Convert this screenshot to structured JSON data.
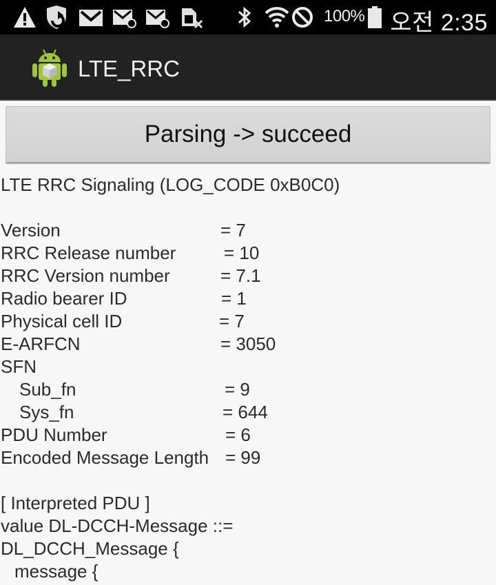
{
  "status_bar": {
    "battery_percent": "100%",
    "time": "오전 2:35",
    "icons": [
      "warning-icon",
      "shield-sync-icon",
      "gmail-icon",
      "email-icon",
      "email-icon",
      "sim-card-icon",
      "bluetooth-icon",
      "wifi-icon",
      "do-not-disturb-icon",
      "battery-icon"
    ]
  },
  "action_bar": {
    "title": "LTE_RRC",
    "icon": "android-robot-icon"
  },
  "parse_button": {
    "label": "Parsing -> succeed"
  },
  "log": {
    "header": "LTE RRC Signaling (LOG_CODE 0xB0C0)",
    "fields": [
      {
        "label": "Version",
        "value": "= 7"
      },
      {
        "label": "RRC Release number",
        "value": "= 10"
      },
      {
        "label": "RRC Version number",
        "value": "= 7.1"
      },
      {
        "label": "Radio bearer ID",
        "value": "= 1"
      },
      {
        "label": "Physical cell ID",
        "value": "= 7"
      },
      {
        "label": "E-ARFCN",
        "value": "= 3050"
      },
      {
        "label": "SFN",
        "value": ""
      },
      {
        "label": "Sub_fn",
        "value": "= 9"
      },
      {
        "label": "Sys_fn",
        "value": "= 644"
      },
      {
        "label": "PDU Number",
        "value": "= 6"
      },
      {
        "label": "Encoded Message Length",
        "value": "= 99"
      }
    ],
    "pdu_header": "[ Interpreted PDU ]",
    "pdu_lines": [
      "value DL-DCCH-Message ::=",
      "DL_DCCH_Message {",
      "message {"
    ]
  }
}
